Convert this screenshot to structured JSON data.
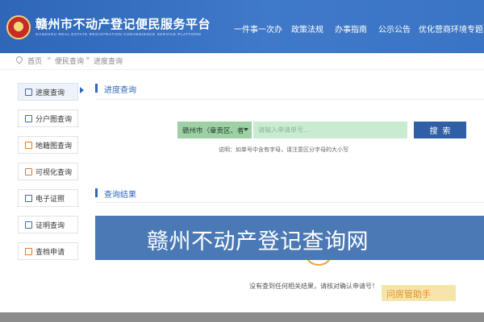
{
  "header": {
    "title": "赣州市不动产登记便民服务平台",
    "subtitle": "GANZHOU REAL ESTATE REGISTRATION CONVENIENCE SERVICE PLATFORM",
    "nav": [
      "一件事一次办",
      "政策法规",
      "办事指南",
      "公示公告",
      "优化营商环境专题"
    ]
  },
  "breadcrumb": [
    "首页",
    "便民查询",
    "进度查询"
  ],
  "sidebar": {
    "items": [
      {
        "label": "进度查询",
        "icon": "search-doc-icon"
      },
      {
        "label": "分户图查询",
        "icon": "floorplan-icon"
      },
      {
        "label": "地籍图查询",
        "icon": "map-icon"
      },
      {
        "label": "可视化查询",
        "icon": "chart-icon"
      },
      {
        "label": "电子证照",
        "icon": "certificate-icon"
      },
      {
        "label": "证明查询",
        "icon": "proof-doc-icon"
      },
      {
        "label": "查档申请",
        "icon": "archive-icon"
      }
    ],
    "active": 0
  },
  "progress": {
    "section_title": "进度查询",
    "region_value": "赣州市（章贡区、者",
    "input_placeholder": "请输入申请单号...",
    "search_label": "搜索",
    "hint": "说明：如单号中含有字母，请注意区分字母的大小写"
  },
  "results": {
    "section_title": "查询结果",
    "message": "没有查到任何相关结果，请核对确认申请号！"
  },
  "banner": {
    "text": "赣州不动产登记查询网"
  },
  "watermark": {
    "text": "问房管助手"
  },
  "colors": {
    "header": "#2f66b8",
    "accent": "#2f5fa5",
    "region": "#9ed0a6",
    "input": "#c8ebd2",
    "banner": "#4a79b6",
    "footer": "#8c8c8c"
  }
}
